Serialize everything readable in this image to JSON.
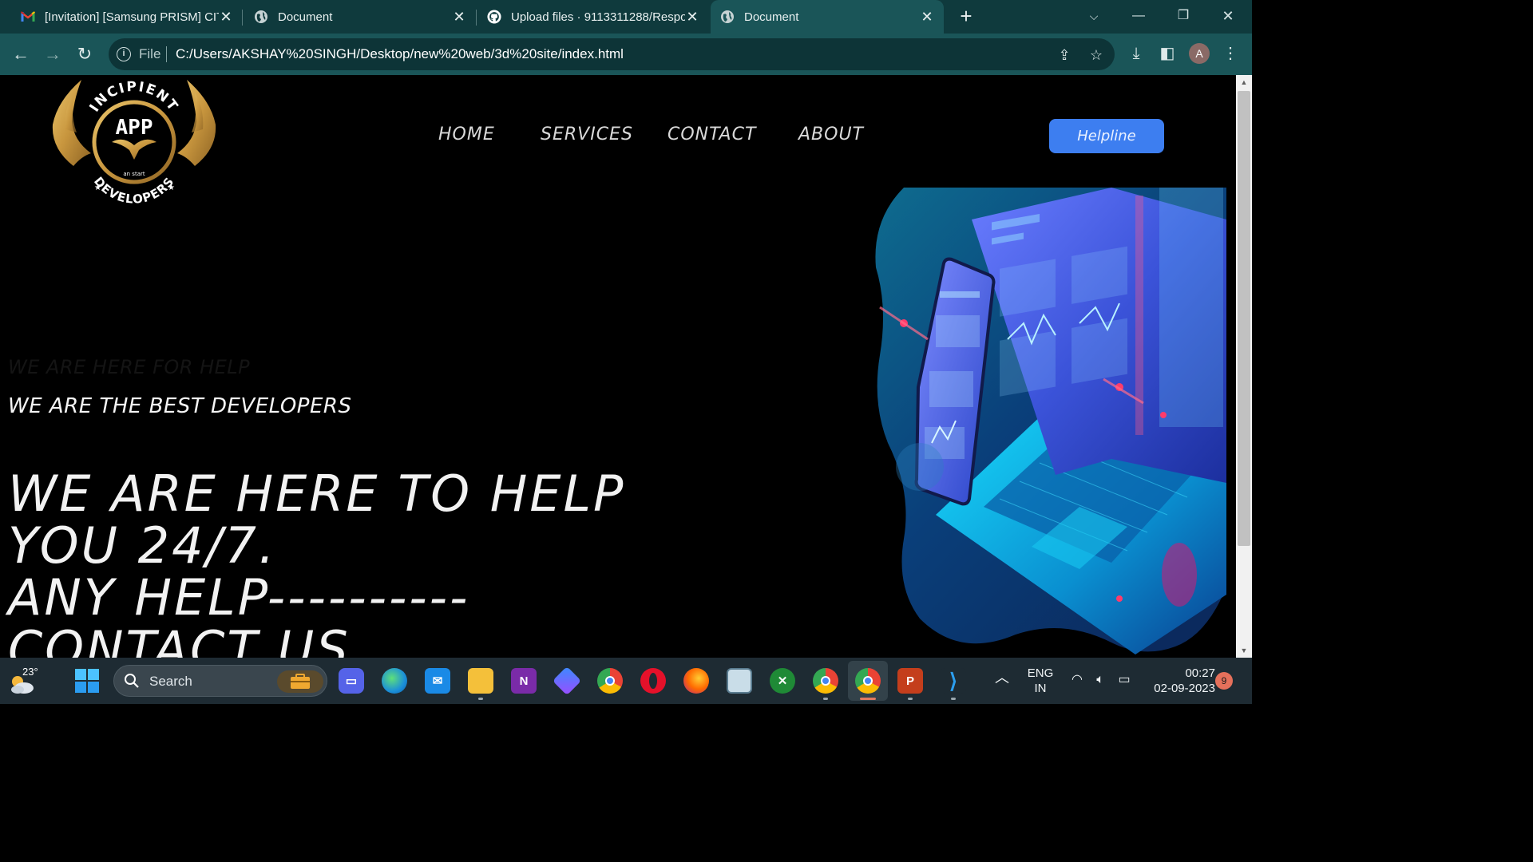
{
  "browser": {
    "tabs": [
      {
        "title": "[Invitation] [Samsung PRISM] CIT",
        "icon": "gmail-icon"
      },
      {
        "title": "Document",
        "icon": "globe-icon"
      },
      {
        "title": "Upload files · 9113311288/Respo",
        "icon": "github-icon"
      },
      {
        "title": "Document",
        "icon": "globe-icon",
        "active": true
      }
    ],
    "scheme_label": "File",
    "url": "C:/Users/AKSHAY%20SINGH/Desktop/new%20web/3d%20site/index.html",
    "profile_initial": "A"
  },
  "page": {
    "logo": {
      "arc_top": "INCIPIENT",
      "center": "APP",
      "tagline": "an start",
      "arc_bottom": "DEVELOPERS"
    },
    "nav": [
      "HOME",
      "SERVICES",
      "CONTACT",
      "ABOUT"
    ],
    "helpline_label": "Helpline",
    "faint_text": "WE ARE HERE FOR HELP",
    "subheading": "WE ARE THE BEST DEVELOPERS",
    "hero_lines": [
      "WE ARE HERE TO HELP",
      "YOU 24/7.",
      "ANY HELP----------",
      "CONTACT US"
    ]
  },
  "taskbar": {
    "weather_temp": "23°",
    "search_label": "Search",
    "lang_line1": "ENG",
    "lang_line2": "IN",
    "time": "00:27",
    "date": "02-09-2023",
    "notification_count": "9"
  }
}
